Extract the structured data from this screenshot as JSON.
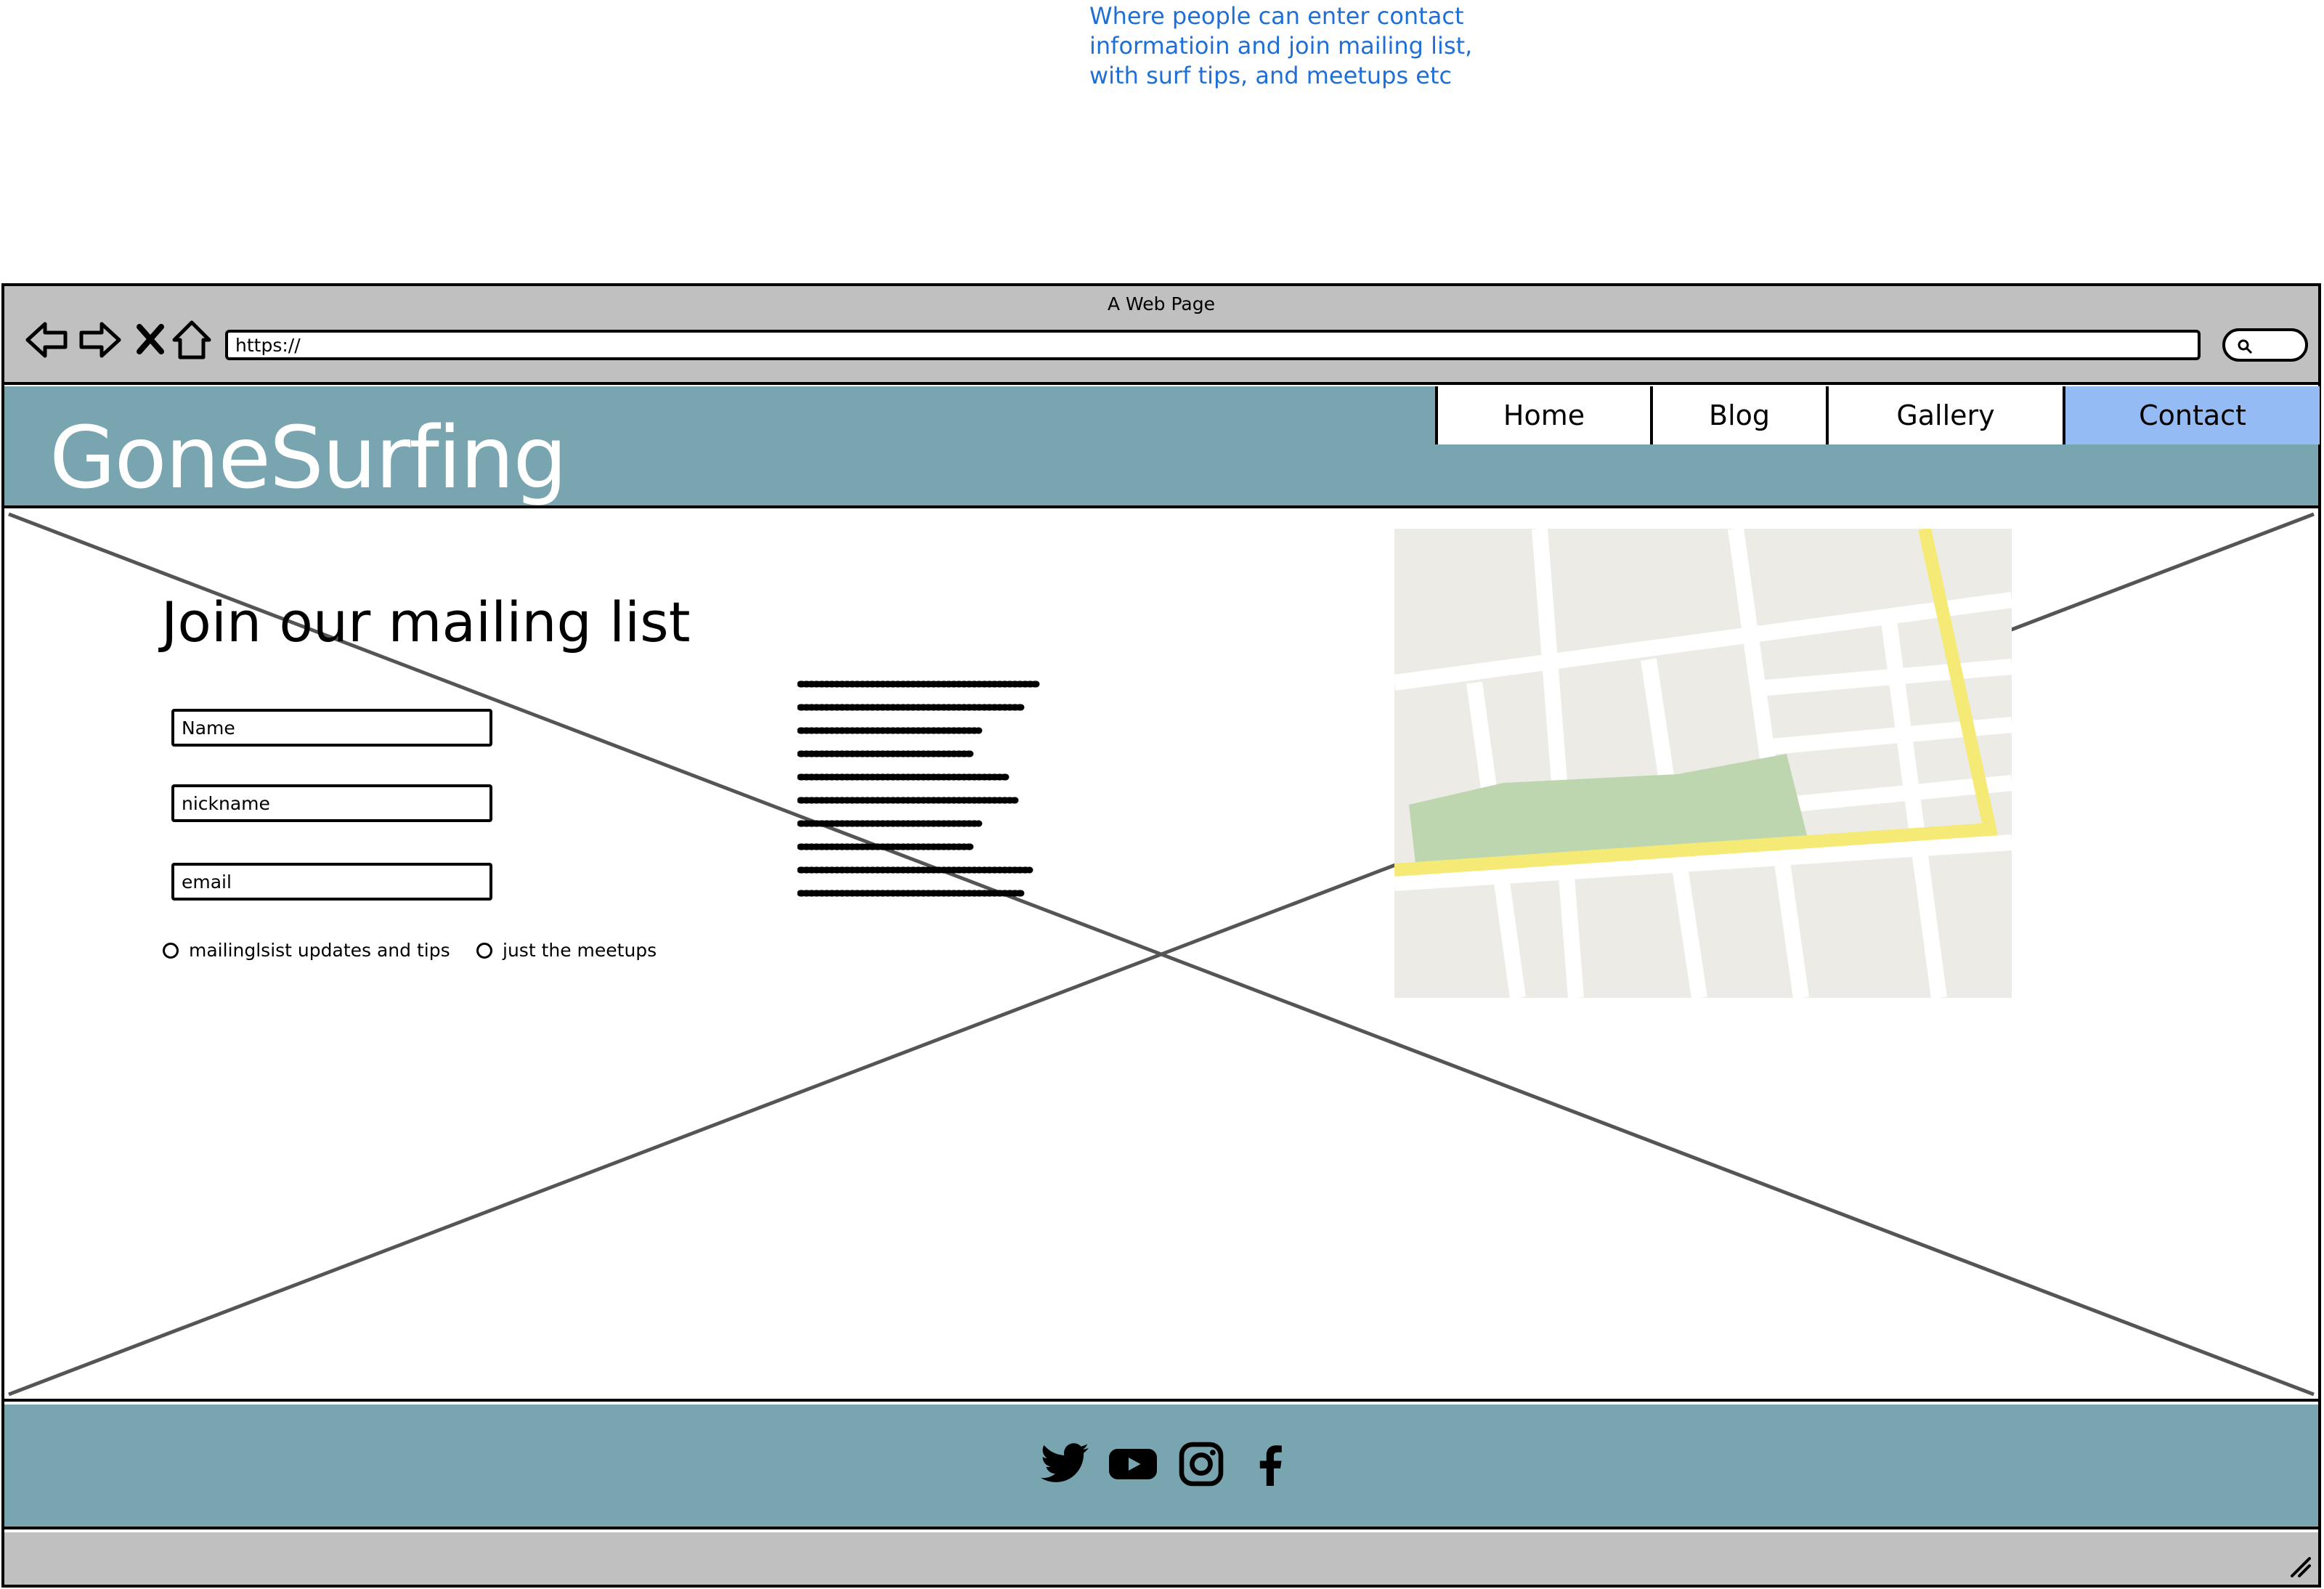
{
  "annotation": {
    "lines": [
      "Where people can enter contact",
      "informatioin and join mailing list,",
      "with surf tips, and meetups etc"
    ],
    "color": "#1f6fd6"
  },
  "browser": {
    "window_title": "A Web Page",
    "url": "https://",
    "nav_icons": [
      "back-arrow-icon",
      "forward-arrow-icon",
      "stop-icon",
      "home-icon"
    ],
    "search_icon": "search-icon"
  },
  "site": {
    "logo": "GoneSurfing",
    "header_color": "#78a5b0",
    "nav": [
      {
        "label": "Home",
        "active": false
      },
      {
        "label": "Blog",
        "active": false
      },
      {
        "label": "Gallery",
        "active": false
      },
      {
        "label": "Contact",
        "active": true
      }
    ],
    "active_color": "#94bbf4"
  },
  "form": {
    "title": "Join our mailing list",
    "fields": [
      {
        "placeholder": "Name"
      },
      {
        "placeholder": "nickname"
      },
      {
        "placeholder": "email"
      }
    ],
    "options": [
      "mailinglsist updates and tips",
      "just the meetups"
    ]
  },
  "footer": {
    "social_icons": [
      "twitter-icon",
      "youtube-icon",
      "instagram-icon",
      "facebook-icon"
    ]
  }
}
